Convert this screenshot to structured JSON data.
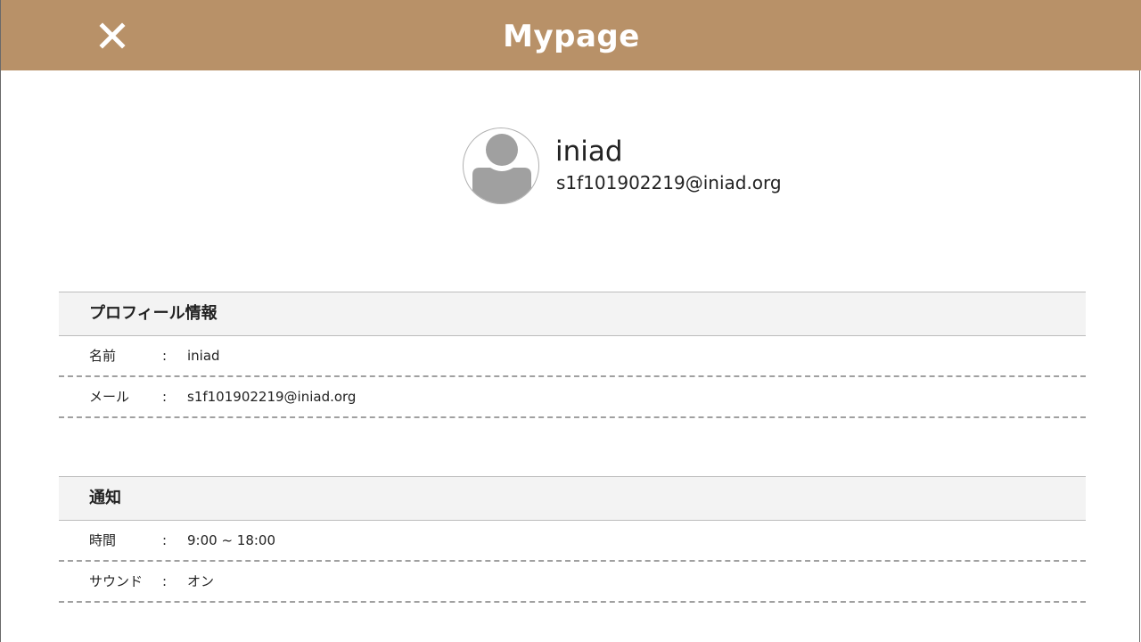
{
  "header": {
    "title": "Mypage",
    "close_icon": "close-icon",
    "background": "#b89168"
  },
  "user": {
    "name": "iniad",
    "email": "s1f101902219@iniad.org",
    "avatar_icon": "user-avatar-icon"
  },
  "profile_section": {
    "title": "プロフィール情報",
    "rows": [
      {
        "label": "名前",
        "colon": ":",
        "value": "iniad"
      },
      {
        "label": "メール",
        "colon": ":",
        "value": "s1f101902219@iniad.org"
      }
    ]
  },
  "notification_section": {
    "title": "通知",
    "rows": [
      {
        "label": "時間",
        "colon": ":",
        "value": "9:00 ~ 18:00"
      },
      {
        "label": "サウンド",
        "colon": ":",
        "value": "オン"
      }
    ]
  }
}
